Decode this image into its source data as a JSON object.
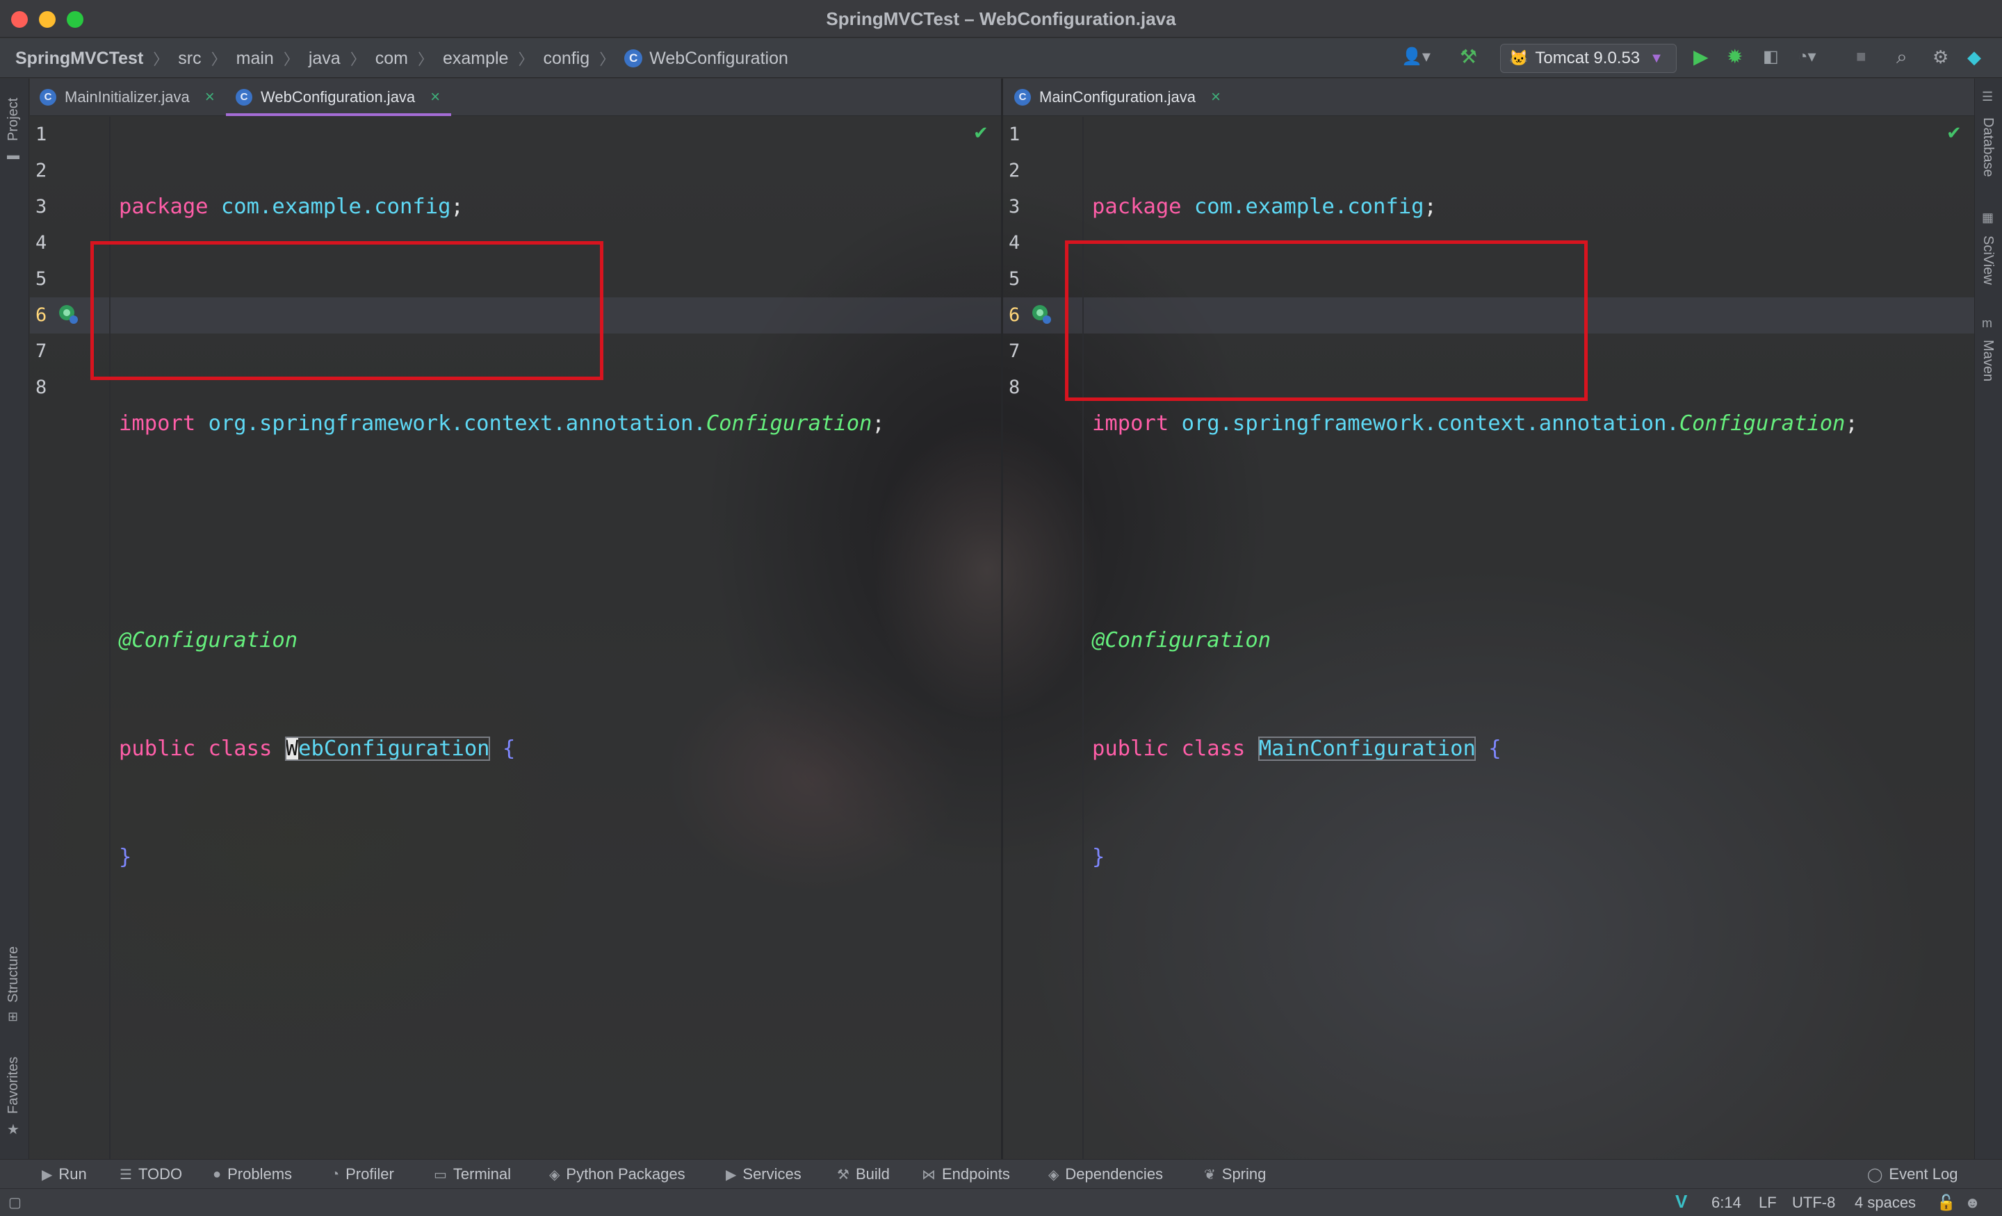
{
  "window": {
    "title": "SpringMVCTest – WebConfiguration.java"
  },
  "breadcrumb": {
    "items": [
      "SpringMVCTest",
      "src",
      "main",
      "java",
      "com",
      "example",
      "config",
      "WebConfiguration"
    ]
  },
  "toolbar": {
    "run_config": "Tomcat 9.0.53"
  },
  "left_sidebar": {
    "project": "Project",
    "structure": "Structure",
    "favorites": "Favorites"
  },
  "right_sidebar": {
    "database": "Database",
    "sciview": "SciView",
    "maven": "Maven"
  },
  "left_pane": {
    "tabs": [
      {
        "label": "MainInitializer.java",
        "active": false
      },
      {
        "label": "WebConfiguration.java",
        "active": true
      }
    ],
    "line_numbers": [
      "1",
      "2",
      "3",
      "4",
      "5",
      "6",
      "7",
      "8"
    ],
    "code": {
      "l1_kw": "package",
      "l1_name": "com.example.config",
      "l1_end": ";",
      "l3_kw": "import",
      "l3_pkg": "org.springframework.context.annotation.",
      "l3_cls": "Configuration",
      "l3_end": ";",
      "l5_annotation": "@Configuration",
      "l6_kw": "public class",
      "l6_caret": "W",
      "l6_cls": "ebConfiguration",
      "l6_brace": "{",
      "l7_brace": "}"
    }
  },
  "right_pane": {
    "tabs": [
      {
        "label": "MainConfiguration.java",
        "active": true
      }
    ],
    "line_numbers": [
      "1",
      "2",
      "3",
      "4",
      "5",
      "6",
      "7",
      "8"
    ],
    "code": {
      "l1_kw": "package",
      "l1_name": "com.example.config",
      "l1_end": ";",
      "l3_kw": "import",
      "l3_pkg": "org.springframework.context.annotation.",
      "l3_cls": "Configuration",
      "l3_end": ";",
      "l5_annotation": "@Configuration",
      "l6_kw": "public class",
      "l6_cls": "MainConfiguration",
      "l6_brace": "{",
      "l7_brace": "}"
    }
  },
  "tool_windows": [
    "Run",
    "TODO",
    "Problems",
    "Profiler",
    "Terminal",
    "Python Packages",
    "Services",
    "Build",
    "Endpoints",
    "Dependencies",
    "Spring"
  ],
  "event_log": "Event Log",
  "status": {
    "position": "6:14",
    "line_sep": "LF",
    "encoding": "UTF-8",
    "indent": "4 spaces"
  },
  "colors": {
    "keyword": "#ff5ea8",
    "identifier": "#5fd9f5",
    "annotation": "#66f07e",
    "brace": "#7f88ff",
    "highlight_box": "#d8141f",
    "active_tab": "#a56dd6"
  }
}
